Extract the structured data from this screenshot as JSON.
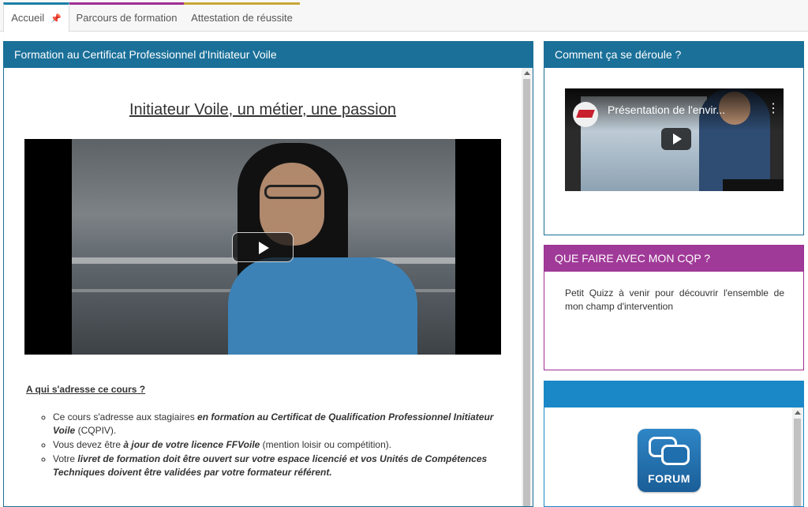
{
  "tabs": [
    {
      "label": "Accueil",
      "pin_icon": "pin-icon"
    },
    {
      "label": "Parcours de formation"
    },
    {
      "label": "Attestation de réussite"
    }
  ],
  "main_panel": {
    "title": "Formation au Certificat Professionnel d'Initiateur Voile",
    "heading": "Initiateur Voile, un métier, une passion",
    "section_title": " A qui s'adresse ce cours ?",
    "bullets": [
      {
        "pre": "Ce cours s'adresse aux stagiaires ",
        "em": "en formation au Certificat de Qualification Professionnel Initiateur Voile",
        "post": " (CQPIV)."
      },
      {
        "pre": "Vous devez être ",
        "em": "à jour de votre licence FFVoile",
        "post": " (mention loisir ou compétition)."
      },
      {
        "pre": "Votre ",
        "em": "livret de formation doit être ouvert sur votre espace licencié et vos Unités de Compétences Techniques doivent être validées par votre formateur référent.",
        "post": ""
      }
    ]
  },
  "right_panel_1": {
    "title": "Comment ça se déroule ?",
    "video_title": "Présentation de l'envir..."
  },
  "right_panel_2": {
    "title": "QUE FAIRE AVEC MON CQP ?",
    "text": "Petit Quizz à venir pour découvrir l'ensemble de mon champ d'intervention"
  },
  "right_panel_3": {
    "forum_label": "FORUM"
  },
  "colors": {
    "primary_blue": "#1a7099",
    "purple": "#a03a98",
    "forum_blue": "#1a87c6"
  }
}
